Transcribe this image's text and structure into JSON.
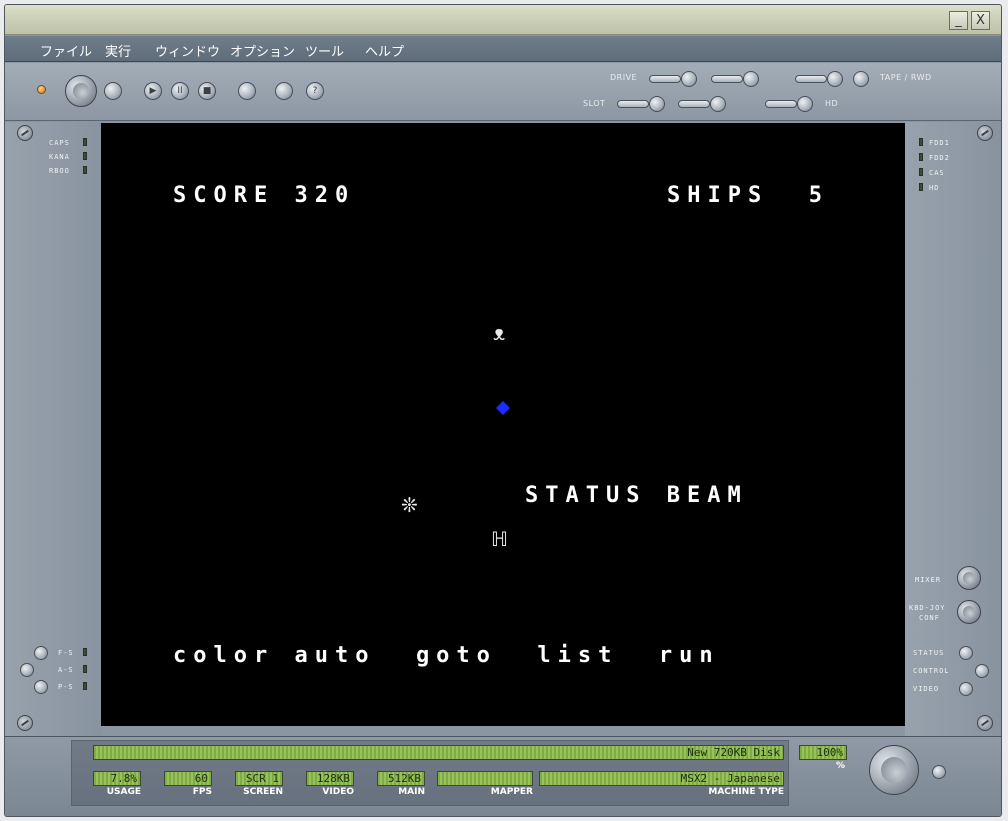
{
  "window": {
    "minimize_glyph": "_",
    "close_glyph": "X"
  },
  "menu": {
    "items": [
      "ファイル",
      "実行",
      "ウィンドウ",
      "オプション",
      "ツール",
      "ヘルプ"
    ]
  },
  "toolbar": {
    "drive_label": "DRIVE",
    "slot_label": "SLOT",
    "tape_label": "TAPE / RWD",
    "hd_label": "HD",
    "play_glyph": "▶",
    "pause_glyph": "II",
    "stop_glyph": "■",
    "help_glyph": "?"
  },
  "left_indicators": {
    "caps": "CAPS",
    "kana": "KANA",
    "rboo": "RBOO",
    "fs": "F-S",
    "as": "A-S",
    "ps": "P-S"
  },
  "right_indicators": {
    "fdd1": "FDD1",
    "fdd2": "FDD2",
    "cas": "CAS",
    "hd": "HD",
    "mixer": "MIXER",
    "kbd_joy": "KBD-JOY",
    "conf": "CONF",
    "status": "STATUS",
    "control": "CONTROL",
    "video": "VIDEO"
  },
  "game": {
    "score": "SCORE 320",
    "ships": "SHIPS  5",
    "status_beam": "STATUS BEAM",
    "function_keys": "color auto  goto  list  run",
    "sprite_enemy": "ᴥ",
    "sprite_mine": "❊",
    "sprite_player": "ℍ",
    "bullet_color": "#1a2cff"
  },
  "status_bar": {
    "disk": "New 720KB Disk",
    "speed": "100%",
    "speed_unit": "%",
    "usage_value": "7.8%",
    "usage_label": "USAGE",
    "fps_value": "60",
    "fps_label": "FPS",
    "screen_value": "SCR 1",
    "screen_label": "SCREEN",
    "video_value": "128KB",
    "video_label": "VIDEO",
    "main_value": "512KB",
    "main_label": "MAIN",
    "mapper_value": "",
    "mapper_label": "MAPPER",
    "machine_value": "MSX2 - Japanese",
    "machine_label": "MACHINE TYPE"
  }
}
